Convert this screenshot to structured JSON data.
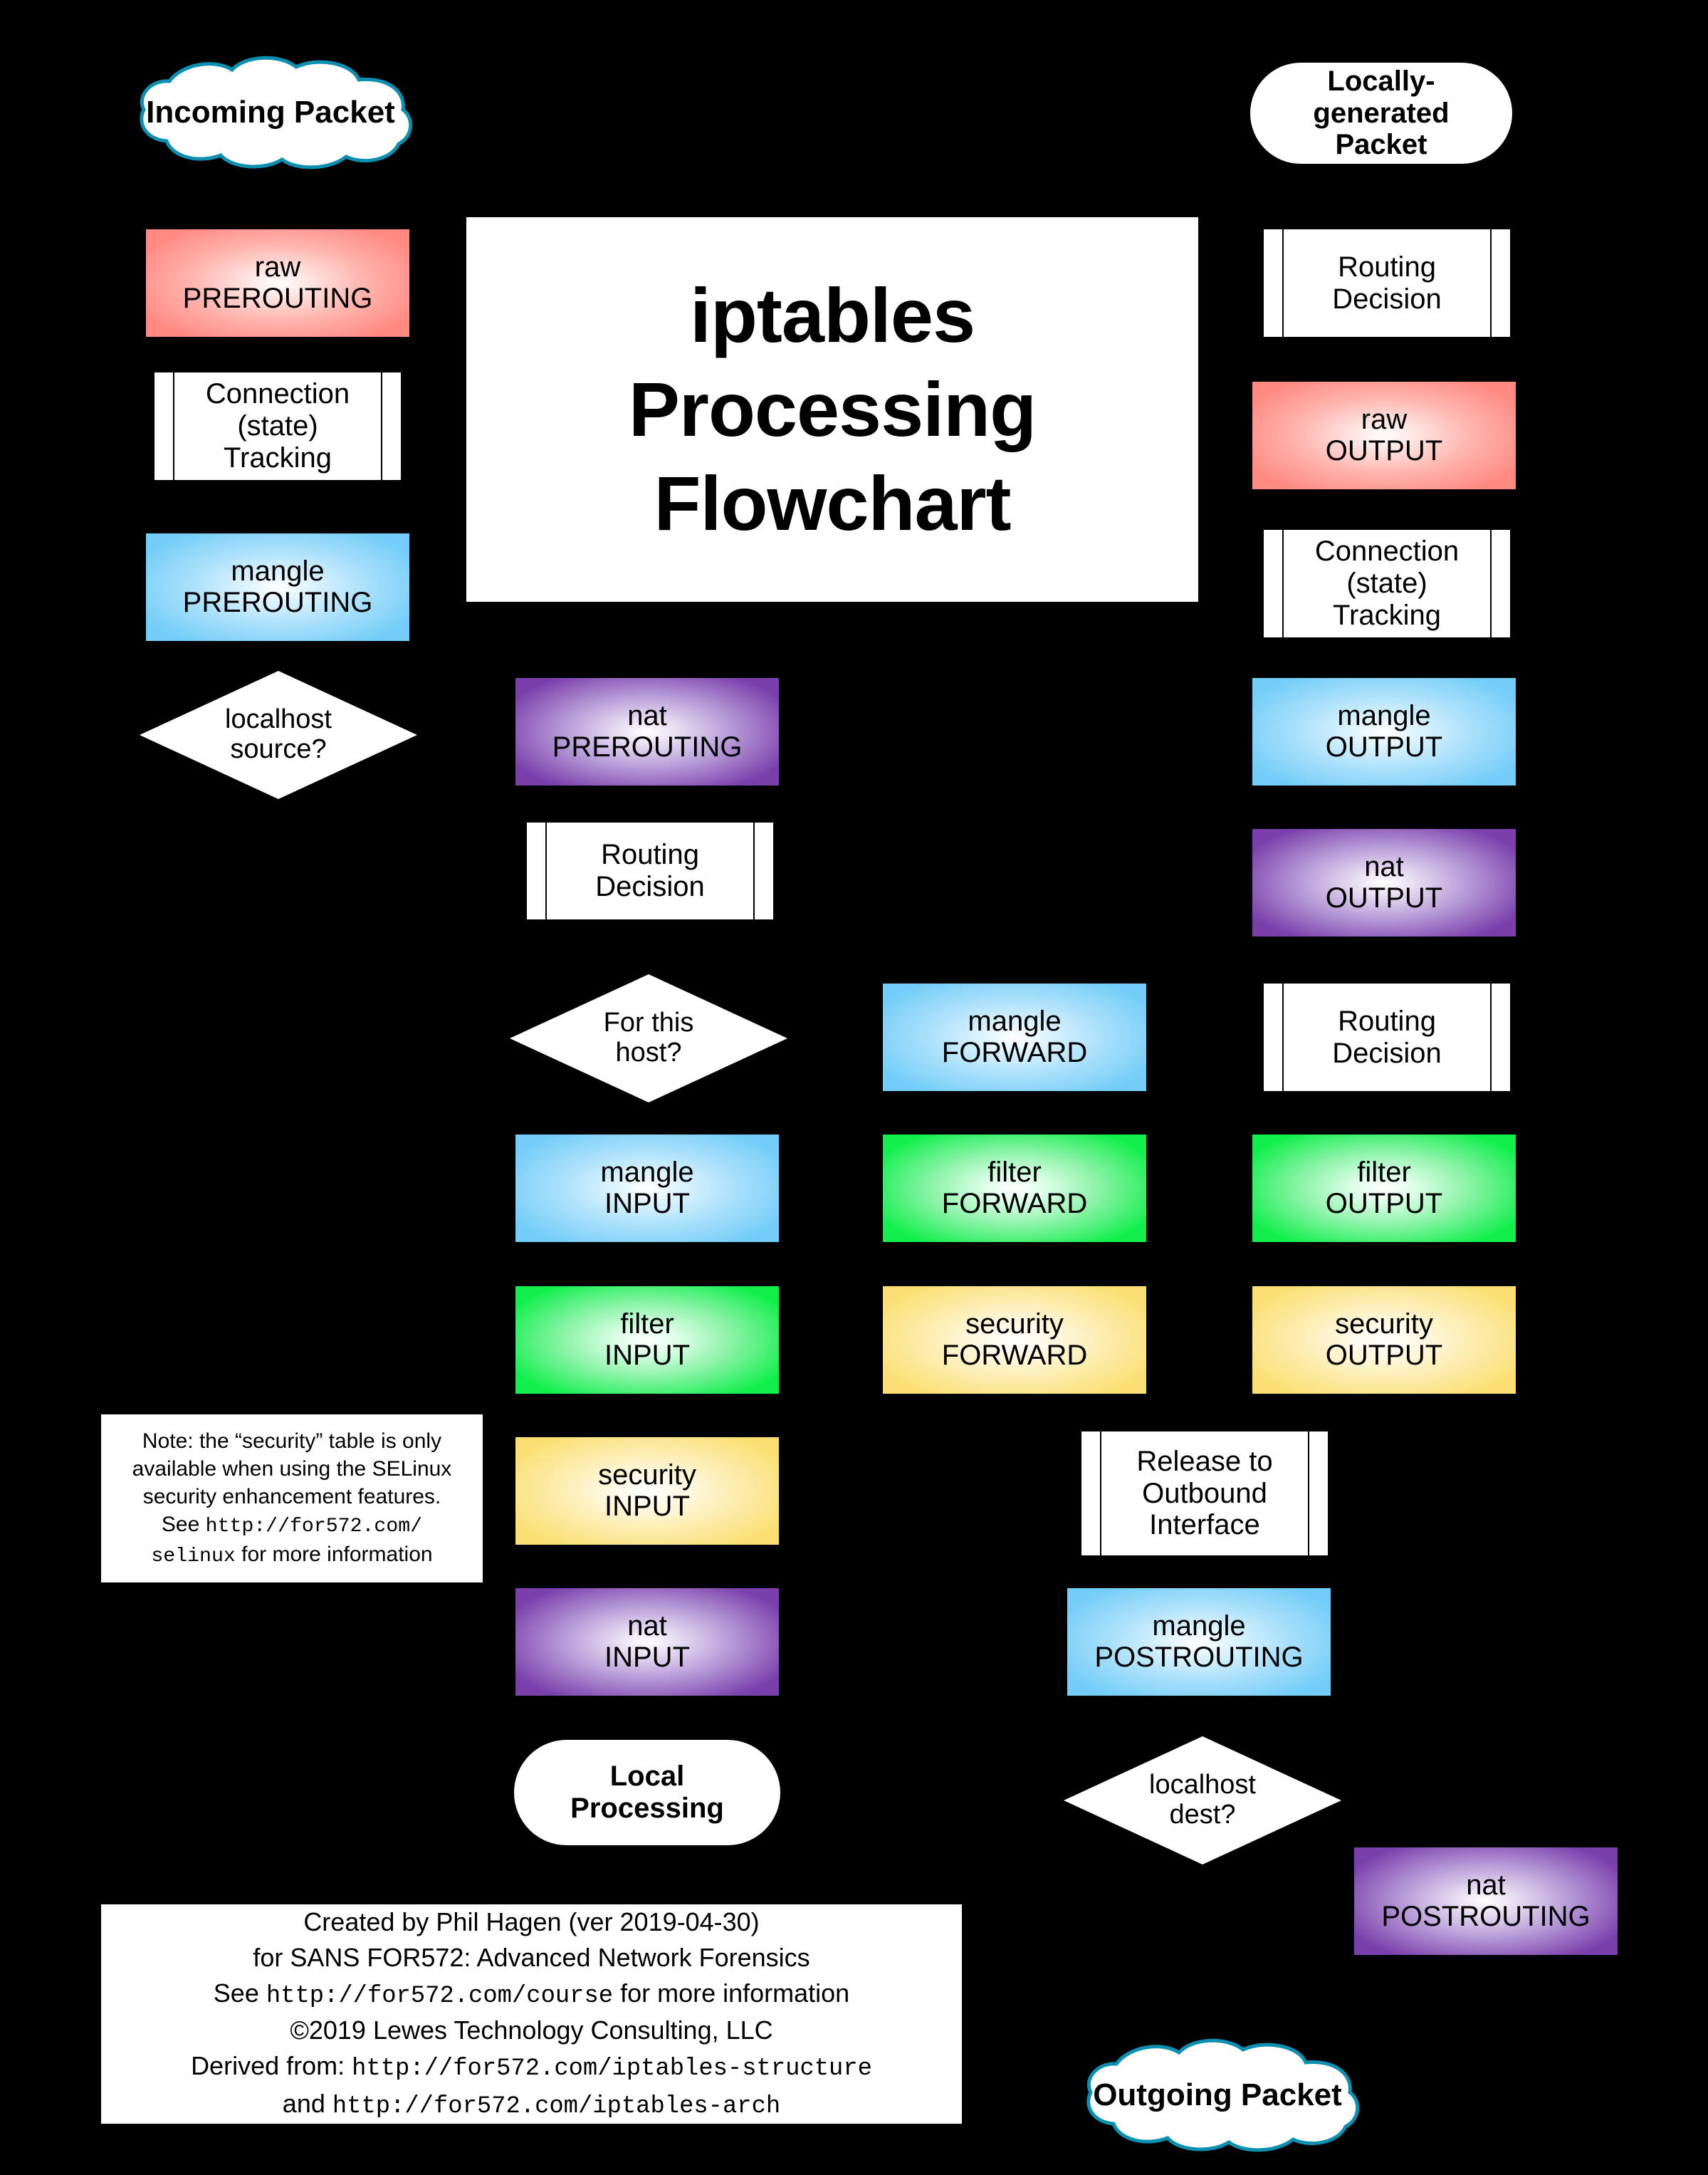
{
  "title": {
    "line1": "iptables",
    "line2": "Processing",
    "line3": "Flowchart"
  },
  "terminators": {
    "incoming_packet": "Incoming Packet",
    "locally_generated_packet": "Locally-generated Packet",
    "locally_generated_l1": "Locally-",
    "locally_generated_l2": "generated",
    "locally_generated_l3": "Packet",
    "local_processing_l1": "Local",
    "local_processing_l2": "Processing",
    "outgoing_packet": "Outgoing Packet"
  },
  "columns": {
    "inbound": {
      "label": "inbound-path",
      "nodes": [
        {
          "table": "raw",
          "chain": "PREROUTING",
          "color": "#ff8a82"
        },
        {
          "table": "Connection",
          "chain": "(state)",
          "chain2": "Tracking",
          "color": "#ffffff"
        },
        {
          "table": "mangle",
          "chain": "PREROUTING",
          "color": "#74cdf8"
        },
        {
          "decision": "localhost",
          "decision2": "source?"
        }
      ]
    },
    "routing": {
      "label": "routing-path",
      "nodes": [
        {
          "table": "nat",
          "chain": "PREROUTING",
          "color": "#7b3fab"
        },
        {
          "table": "Routing",
          "chain": "Decision",
          "color": "#ffffff"
        },
        {
          "decision": "For this",
          "decision2": "host?"
        },
        {
          "table": "mangle",
          "chain": "INPUT",
          "color": "#74cdf8"
        },
        {
          "table": "filter",
          "chain": "INPUT",
          "color": "#12ef4d"
        },
        {
          "table": "security",
          "chain": "INPUT",
          "color": "#fbdf74"
        },
        {
          "table": "nat",
          "chain": "INPUT",
          "color": "#7b3fab"
        }
      ]
    },
    "forward": {
      "label": "forward-path",
      "nodes": [
        {
          "table": "mangle",
          "chain": "FORWARD",
          "color": "#74cdf8"
        },
        {
          "table": "filter",
          "chain": "FORWARD",
          "color": "#12ef4d"
        },
        {
          "table": "security",
          "chain": "FORWARD",
          "color": "#fbdf74"
        }
      ]
    },
    "output": {
      "label": "output-path",
      "nodes": [
        {
          "table": "Routing",
          "chain": "Decision",
          "color": "#ffffff"
        },
        {
          "table": "raw",
          "chain": "OUTPUT",
          "color": "#ff8a82"
        },
        {
          "table": "Connection",
          "chain": "(state)",
          "chain2": "Tracking",
          "color": "#ffffff"
        },
        {
          "table": "mangle",
          "chain": "OUTPUT",
          "color": "#74cdf8"
        },
        {
          "table": "nat",
          "chain": "OUTPUT",
          "color": "#7b3fab"
        },
        {
          "table": "Routing",
          "chain": "Decision",
          "color": "#ffffff"
        },
        {
          "table": "filter",
          "chain": "OUTPUT",
          "color": "#12ef4d"
        },
        {
          "table": "security",
          "chain": "OUTPUT",
          "color": "#fbdf74"
        }
      ]
    },
    "postrouting": {
      "label": "postrouting-path",
      "nodes": [
        {
          "table": "Release to",
          "chain": "Outbound",
          "chain2": "Interface",
          "color": "#ffffff"
        },
        {
          "table": "mangle",
          "chain": "POSTROUTING",
          "color": "#74cdf8"
        },
        {
          "decision": "localhost",
          "decision2": "dest?"
        },
        {
          "table": "nat",
          "chain": "POSTROUTING",
          "color": "#7b3fab"
        }
      ]
    }
  },
  "boxes": {
    "raw_prerouting_l1": "raw",
    "raw_prerouting_l2": "PREROUTING",
    "conn_track_in_l1": "Connection",
    "conn_track_in_l2": "(state)",
    "conn_track_in_l3": "Tracking",
    "mangle_prerouting_l1": "mangle",
    "mangle_prerouting_l2": "PREROUTING",
    "localhost_source_l1": "localhost",
    "localhost_source_l2": "source?",
    "nat_prerouting_l1": "nat",
    "nat_prerouting_l2": "PREROUTING",
    "routing_decision_mid_l1": "Routing",
    "routing_decision_mid_l2": "Decision",
    "for_this_host_l1": "For this",
    "for_this_host_l2": "host?",
    "mangle_input_l1": "mangle",
    "mangle_input_l2": "INPUT",
    "filter_input_l1": "filter",
    "filter_input_l2": "INPUT",
    "security_input_l1": "security",
    "security_input_l2": "INPUT",
    "nat_input_l1": "nat",
    "nat_input_l2": "INPUT",
    "mangle_forward_l1": "mangle",
    "mangle_forward_l2": "FORWARD",
    "filter_forward_l1": "filter",
    "filter_forward_l2": "FORWARD",
    "security_forward_l1": "security",
    "security_forward_l2": "FORWARD",
    "routing_decision_top_l1": "Routing",
    "routing_decision_top_l2": "Decision",
    "raw_output_l1": "raw",
    "raw_output_l2": "OUTPUT",
    "conn_track_out_l1": "Connection",
    "conn_track_out_l2": "(state)",
    "conn_track_out_l3": "Tracking",
    "mangle_output_l1": "mangle",
    "mangle_output_l2": "OUTPUT",
    "nat_output_l1": "nat",
    "nat_output_l2": "OUTPUT",
    "routing_decision_right_l1": "Routing",
    "routing_decision_right_l2": "Decision",
    "filter_output_l1": "filter",
    "filter_output_l2": "OUTPUT",
    "security_output_l1": "security",
    "security_output_l2": "OUTPUT",
    "release_outbound_l1": "Release to",
    "release_outbound_l2": "Outbound",
    "release_outbound_l3": "Interface",
    "mangle_postrouting_l1": "mangle",
    "mangle_postrouting_l2": "POSTROUTING",
    "localhost_dest_l1": "localhost",
    "localhost_dest_l2": "dest?",
    "nat_postrouting_l1": "nat",
    "nat_postrouting_l2": "POSTROUTING"
  },
  "note": {
    "line1": "Note: the “security” table is only",
    "line2": "available when using the SELinux",
    "line3": "security enhancement features.",
    "line4_pre": "See ",
    "line4_url": "http://for572.com/",
    "line5_url": "selinux",
    "line5_post": " for more information"
  },
  "credits": {
    "line1": "Created by Phil Hagen (ver 2019-04-30)",
    "line2": "for SANS FOR572: Advanced Network Forensics",
    "line3_pre": "See ",
    "line3_url": "http://for572.com/course",
    "line3_post": " for more information",
    "line4": "©2019 Lewes Technology Consulting, LLC",
    "line5_pre": "Derived from: ",
    "line5_url": "http://for572.com/iptables-structure",
    "line6_pre": "and ",
    "line6_url": "http://for572.com/iptables-arch"
  },
  "colors": {
    "background": "#000000",
    "raw": "#ff8a82",
    "mangle": "#74cdf8",
    "nat": "#7b3fab",
    "filter": "#12ef4d",
    "security": "#fbdf74",
    "neutral": "#ffffff",
    "cloud_outline": "#0d8fb0"
  }
}
